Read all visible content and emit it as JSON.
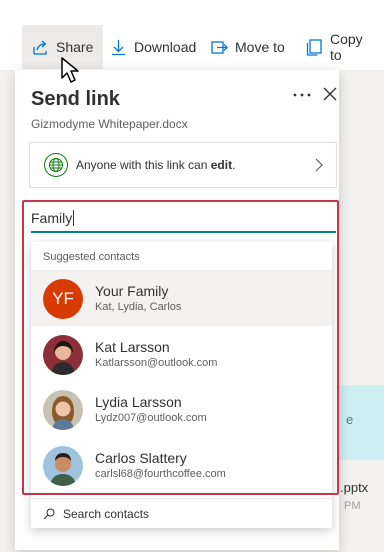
{
  "toolbar": {
    "share_label": "Share",
    "download_label": "Download",
    "move_label": "Move to",
    "copy_label": "Copy to"
  },
  "panel": {
    "title": "Send link",
    "file_name": "Gizmodyme Whitepaper.docx",
    "more_icon": "more-icon",
    "close_icon": "close-icon",
    "permission_prefix": "Anyone with this link can ",
    "permission_level": "edit",
    "permission_suffix": ".",
    "recipient_value": "Family"
  },
  "dropdown": {
    "header": "Suggested contacts",
    "contacts": [
      {
        "name": "Your Family",
        "detail": "Kat, Lydia, Carlos",
        "initials": "YF",
        "selected": true
      },
      {
        "name": "Kat Larsson",
        "detail": "Katlarsson@outlook.com"
      },
      {
        "name": "Lydia Larsson",
        "detail": "Lydz007@outlook.com"
      },
      {
        "name": "Carlos Slattery",
        "detail": "carlsl68@fourthcoffee.com"
      }
    ],
    "search_label": "Search contacts"
  },
  "background": {
    "file_ext": ".pptx",
    "time_suffix": "PM",
    "tile_letter": "e"
  },
  "colors": {
    "accent": "#0078d4",
    "highlight_box": "#c7364a",
    "input_underline": "#038387",
    "avatar_initials_bg": "#d83b01",
    "globe": "#107c10"
  }
}
